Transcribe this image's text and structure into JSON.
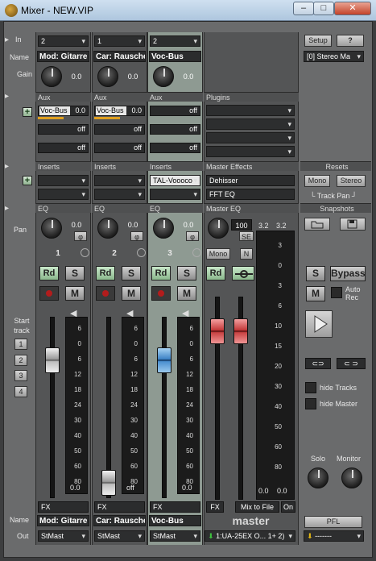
{
  "window": {
    "title": "Mixer - NEW.VIP",
    "minimize": "–",
    "maximize": "□",
    "close": "✕"
  },
  "left": {
    "in_label": "In",
    "name_label": "Name",
    "gain_label": "Gain",
    "aux_label": "Aux",
    "inserts_label": "Inserts",
    "eq_label": "EQ",
    "pan_label": "Pan",
    "start_track_label": "Start track",
    "start_track_buttons": [
      "1",
      "2",
      "3",
      "4"
    ],
    "name_label_bottom": "Name",
    "out_label": "Out"
  },
  "channels": [
    {
      "number": "1",
      "in": "2",
      "name": "Mod: Gitarre",
      "gain": "0.0",
      "aux_header": "Aux",
      "aux": [
        {
          "name": "Voc-Bus",
          "value": "0.0",
          "bar": "#e0a020"
        },
        {
          "name": "",
          "value": "off"
        },
        {
          "name": "",
          "value": "off"
        }
      ],
      "inserts_header": "Inserts",
      "inserts": [
        "",
        ""
      ],
      "eq_header": "EQ",
      "pan": "0.0",
      "phase": "φ",
      "rd": "Rd",
      "s": "S",
      "m": "M",
      "scale": [
        "6",
        "0",
        "6",
        "12",
        "18",
        "24",
        "30",
        "40",
        "50",
        "60",
        "80"
      ],
      "fader_value": "0.0",
      "meter_top": "6",
      "fx": "FX",
      "out": "StMast",
      "fader_color": "grey",
      "fader_level": 0.8
    },
    {
      "number": "2",
      "in": "1",
      "name": "Car: Rausche",
      "gain": "0.0",
      "aux_header": "Aux",
      "aux": [
        {
          "name": "Voc-Bus",
          "value": "0.0",
          "bar": "#e0a020"
        },
        {
          "name": "",
          "value": "off"
        },
        {
          "name": "",
          "value": "off"
        }
      ],
      "inserts_header": "Inserts",
      "inserts": [
        "",
        ""
      ],
      "eq_header": "EQ",
      "pan": "0.0",
      "phase": "φ",
      "rd": "Rd",
      "s": "S",
      "m": "M",
      "scale": [
        "6",
        "0",
        "6",
        "12",
        "18",
        "24",
        "30",
        "40",
        "50",
        "60",
        "80"
      ],
      "fader_value": "off",
      "meter_top": "6",
      "fx": "FX",
      "out": "StMast",
      "fader_color": "grey",
      "fader_level": 0.0
    },
    {
      "number": "3",
      "in": "2",
      "name": "Voc-Bus",
      "gain": "0.0",
      "aux_header": "Aux",
      "aux": [
        {
          "name": "",
          "value": "off"
        },
        {
          "name": "",
          "value": "off"
        },
        {
          "name": "",
          "value": "off"
        }
      ],
      "inserts_header": "Inserts",
      "inserts": [
        "TAL-Voooco",
        ""
      ],
      "eq_header": "EQ",
      "pan": "0.0",
      "phase": "φ",
      "rd": "Rd",
      "s": "S",
      "m": "M",
      "scale": [
        "6",
        "0",
        "6",
        "12",
        "18",
        "24",
        "30",
        "40",
        "50",
        "60",
        "80"
      ],
      "fader_value": "0.0",
      "meter_top": "6",
      "fx": "FX",
      "out": "StMast",
      "fader_color": "blue",
      "fader_level": 0.8
    }
  ],
  "master": {
    "plugins_header": "Plugins",
    "plugins": [
      "",
      "",
      "",
      ""
    ],
    "effects_header": "Master Effects",
    "effects": [
      "Dehisser",
      "FFT EQ"
    ],
    "eq_header": "Master EQ",
    "pan": "100",
    "se": "SE",
    "mono": "Mono",
    "n": "N",
    "rd": "Rd",
    "meter_top_left": "3.2",
    "meter_top_right": "3.2",
    "scale": [
      "3",
      "0",
      "3",
      "6",
      "10",
      "15",
      "20",
      "30",
      "40",
      "50",
      "60",
      "80"
    ],
    "fader_left": "0.0",
    "fader_right": "0.0",
    "fx": "FX",
    "mix_to_file": "Mix to File",
    "on": "On",
    "name": "master",
    "out": "1:UA-25EX O... 1+ 2)"
  },
  "right": {
    "setup": "Setup",
    "help": "?",
    "stereo": "[0] Stereo Ma",
    "resets_header": "Resets",
    "mono": "Mono",
    "stereo_btn": "Stereo",
    "track_pan": "Track Pan",
    "snapshots_header": "Snapshots",
    "s": "S",
    "bypass": "Bypass",
    "m": "M",
    "auto_rec": "Auto Rec",
    "hide_tracks": "hide Tracks",
    "hide_master": "hide Master",
    "solo": "Solo",
    "monitor": "Monitor",
    "pfl": "PFL",
    "out": "-------"
  }
}
